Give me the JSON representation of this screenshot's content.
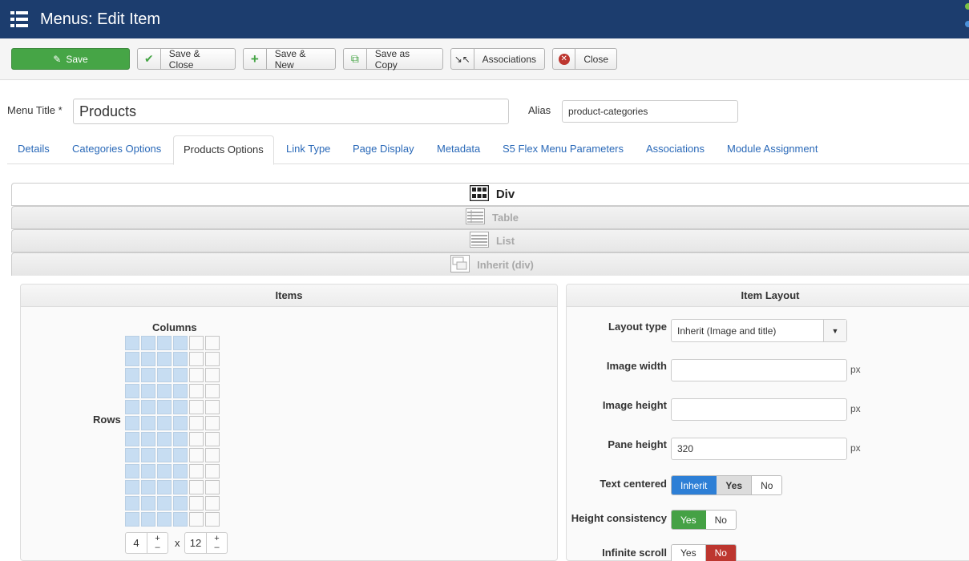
{
  "header": {
    "title": "Menus: Edit Item",
    "menu_icon": "grid-menu-icon"
  },
  "toolbar": {
    "save": "Save",
    "save_close": "Save & Close",
    "save_new": "Save & New",
    "save_copy": "Save as Copy",
    "associations": "Associations",
    "close": "Close"
  },
  "form": {
    "menu_title_label": "Menu Title *",
    "menu_title_value": "Products",
    "alias_label": "Alias",
    "alias_value": "product-categories"
  },
  "tabs": [
    {
      "label": "Details"
    },
    {
      "label": "Categories Options"
    },
    {
      "label": "Products Options"
    },
    {
      "label": "Link Type"
    },
    {
      "label": "Page Display"
    },
    {
      "label": "Metadata"
    },
    {
      "label": "S5 Flex Menu Parameters"
    },
    {
      "label": "Associations"
    },
    {
      "label": "Module Assignment"
    }
  ],
  "active_tab": "Products Options",
  "layouts": [
    {
      "label": "Div",
      "active": true
    },
    {
      "label": "Table",
      "active": false
    },
    {
      "label": "List",
      "active": false
    },
    {
      "label": "Inherit (div)",
      "active": false
    }
  ],
  "items_panel": {
    "title": "Items",
    "columns_label": "Columns",
    "rows_label": "Rows",
    "columns_selected": "4",
    "rows_selected": "12",
    "x_label": "x",
    "plus": "+",
    "minus": "–"
  },
  "item_layout": {
    "title": "Item Layout",
    "layout_type_label": "Layout type",
    "layout_type_value": "Inherit (Image and title)",
    "image_width_label": "Image width",
    "image_width_value": "",
    "image_height_label": "Image height",
    "image_height_value": "",
    "pane_height_label": "Pane height",
    "pane_height_value": "320",
    "unit": "px",
    "text_centered_label": "Text centered",
    "text_centered_options": [
      "Inherit",
      "Yes",
      "No"
    ],
    "height_consistency_label": "Height consistency",
    "height_consistency_options": [
      "Yes",
      "No"
    ],
    "infinite_scroll_label": "Infinite scroll",
    "infinite_scroll_options": [
      "Yes",
      "No"
    ]
  },
  "colors": {
    "header_bg": "#1c3d6e",
    "save_green": "#46a546",
    "link_blue": "#2a69b8",
    "inherit_blue": "#2d7fd6",
    "yes_green": "#45a145",
    "no_red": "#bd362f"
  }
}
